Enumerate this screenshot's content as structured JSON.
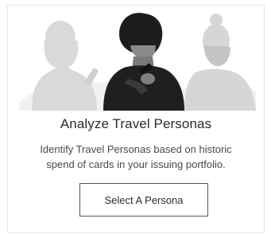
{
  "card": {
    "title": "Analyze Travel Personas",
    "description_lines": [
      "Identify Travel Personas based on historic",
      "spend of cards in your issuing portfolio."
    ],
    "button_label": "Select A Persona",
    "illustration_icon": "travel-personas-illustration",
    "colors": {
      "text": "#2b2b2b",
      "muted_text": "#4a4a4a",
      "button_border": "#555555",
      "card_border": "#e3e3e3"
    }
  }
}
